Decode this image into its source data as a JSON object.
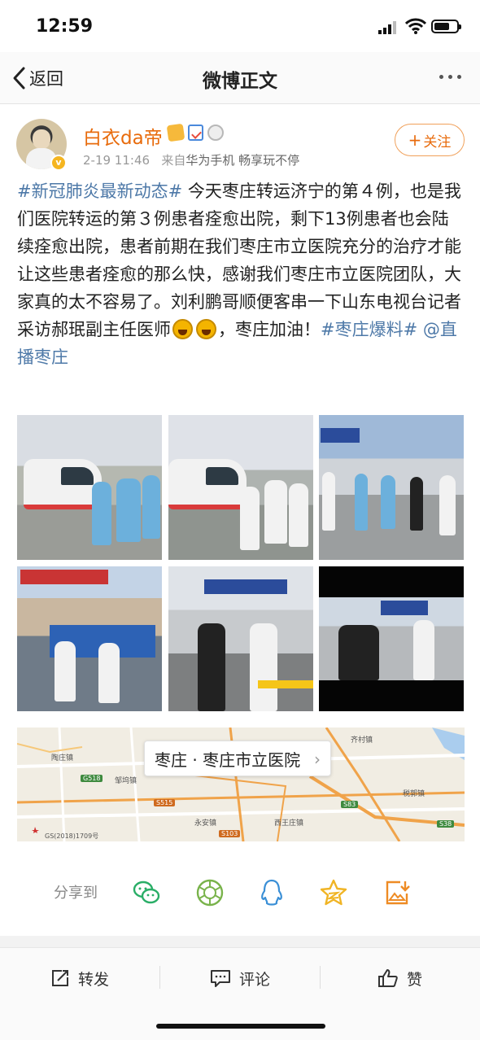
{
  "status_bar": {
    "time": "12:59"
  },
  "nav": {
    "back_label": "返回",
    "title": "微博正文"
  },
  "author": {
    "name": "白衣da帝",
    "time": "2-19 11:46",
    "source_prefix": "来自",
    "source": "华为手机 畅享玩不停",
    "follow_label": "关注"
  },
  "post": {
    "tag1": "#新冠肺炎最新动态#",
    "text1": " 今天枣庄转运济宁的第４例，也是我们医院转运的第３例患者痊愈出院，剩下13例患者也会陆续痊愈出院，患者前期在我们枣庄市立医院充分的治疗才能让这些患者痊愈的那么快，感谢我们枣庄市立医院团队，大家真的太不容易了。刘利鹏哥顺便客串一下山东电视台记者采访郝珉副主任医师",
    "text2": "，枣庄加油！",
    "tag2": "#枣庄爆料#",
    "mention": " @直播枣庄"
  },
  "photos": [
    {
      "name": "photo-ambulance-staff",
      "sign": ""
    },
    {
      "name": "photo-ambulance-ppe",
      "sign": ""
    },
    {
      "name": "photo-police-station-group",
      "sign": "POLICE"
    },
    {
      "name": "photo-jining-hospital",
      "sign": "济宁"
    },
    {
      "name": "photo-police-interview",
      "sign": "公安 POLICE"
    },
    {
      "name": "photo-tv-interview",
      "sign": "公安 POLICE"
    }
  ],
  "map": {
    "location": "枣庄 · 枣庄市立医院",
    "labels": [
      "陶庄镇",
      "齐村镇",
      "邹坞镇",
      "永安镇",
      "西王庄镇",
      "税郭镇",
      "GS(2018)1709号"
    ],
    "road_shields": [
      "G518",
      "S515",
      "S103",
      "S83",
      "S38"
    ],
    "colors": {
      "road_major": "#f0a34a",
      "road_minor": "#ffffff",
      "land": "#f1ede3",
      "water": "#aacdee"
    }
  },
  "share": {
    "label": "分享到",
    "targets": [
      "wechat-icon",
      "moments-icon",
      "qq-icon",
      "qzone-icon",
      "save-image-icon"
    ]
  },
  "actions": {
    "repost": "转发",
    "comment": "评论",
    "like": "赞"
  },
  "colors": {
    "link": "#4e79a8",
    "username": "#e86b0c",
    "follow_border": "#f0a05a"
  }
}
